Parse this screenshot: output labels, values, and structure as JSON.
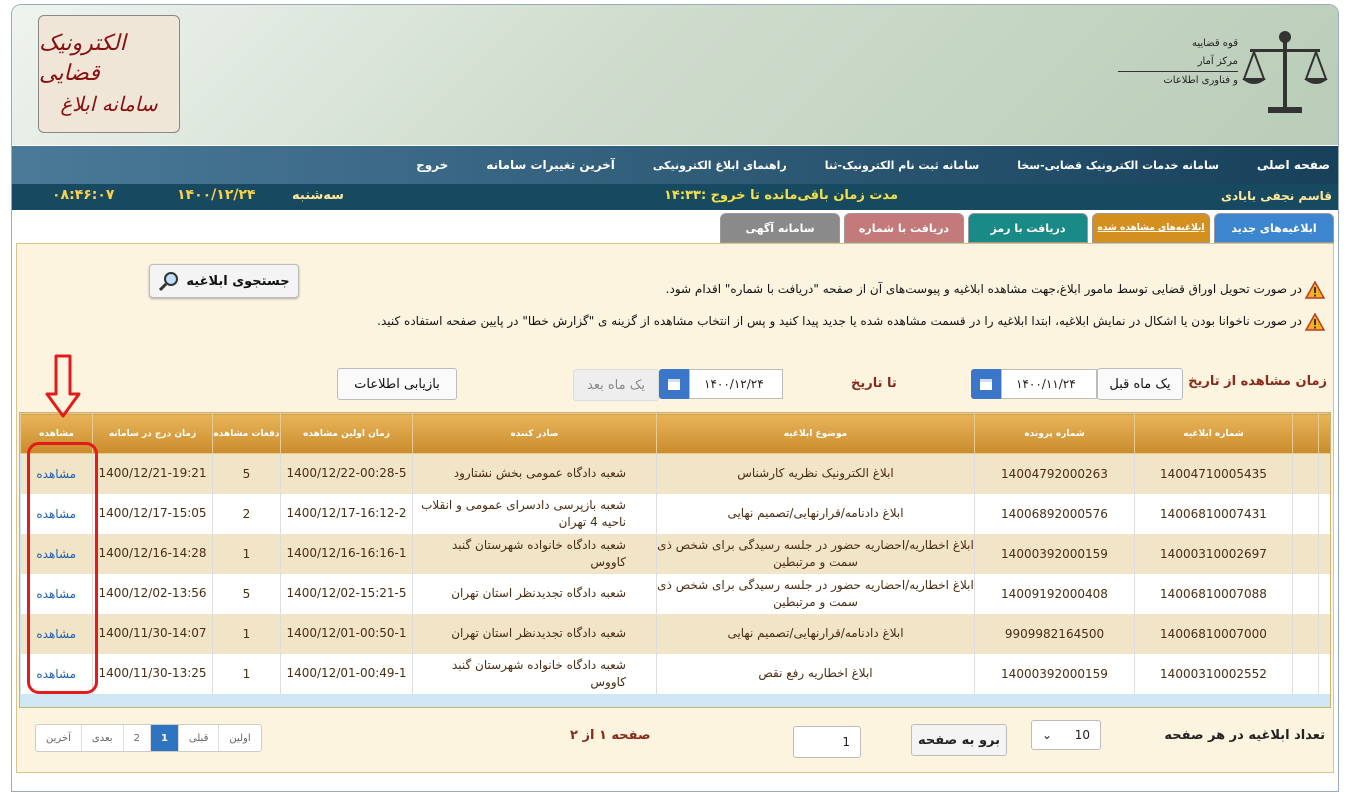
{
  "header": {
    "logo_left_line1": "الکترونیک قضایی",
    "logo_left_line2": "سامانه ابلاغ",
    "org_line1": "قوه قضاییه",
    "org_line2": "مرکز آمار",
    "org_line3": "و فناوری اطلاعات"
  },
  "nav": [
    "صفحه اصلی",
    "سامانه خدمات الکترونیک قضایی-سخا",
    "سامانه ثبت نام الکترونیک-ثنا",
    "راهنمای ابلاغ الکترونیکی",
    "آخرین تغییرات سامانه",
    "خروج"
  ],
  "status": {
    "user": "قاسم نجفی بابادی",
    "timer": "مدت زمان باقی‌مانده تا خروج :۱۴:۳۳",
    "day": "سه‌شنبه",
    "date": "۱۴۰۰/۱۲/۲۴",
    "clock": "۰۸:۴۶:۰۷"
  },
  "tabs": [
    {
      "label": "ابلاغیه‌های جدید",
      "color": "#3b86cf"
    },
    {
      "label": "ابلاغیه‌های مشاهده شده",
      "color": "#d4901e"
    },
    {
      "label": "دریافت با رمز",
      "color": "#1a8a86"
    },
    {
      "label": "دریافت با شماره",
      "color": "#c47a7a"
    },
    {
      "label": "سامانه آگهی",
      "color": "#8a8a8a"
    }
  ],
  "search_button": "جستجوی ابلاغیه",
  "notice1": "در صورت تحویل اوراق قضایی توسط مامور ابلاغ،جهت مشاهده ابلاغیه و پیوست‌های آن از صفحه \"دریافت با شماره\" اقدام شود.",
  "notice2": "در صورت ناخوانا بودن یا اشکال در نمایش ابلاغیه، ابتدا ابلاغیه را در قسمت مشاهده شده یا جدید پیدا کنید و پس از انتخاب مشاهده از گزینه ی \"گزارش خطا\" در پایین صفحه استفاده کنید.",
  "filters": {
    "from_label": "زمان مشاهده از تاریخ",
    "month_before_btn": "یک ماه قبل",
    "from_date": "۱۴۰۰/۱۱/۲۴",
    "to_label": "تا تاریخ",
    "to_date": "۱۴۰۰/۱۲/۲۴",
    "month_after_btn": "یک ماه بعد",
    "refresh_btn": "بازیابی اطلاعات"
  },
  "table": {
    "headers": [
      "شماره ابلاغیه",
      "شماره پرونده",
      "موضوع ابلاغیه",
      "صادر کننده",
      "زمان اولین مشاهده",
      "دفعات مشاهده",
      "زمان درج در سامانه",
      "مشاهده"
    ],
    "rows": [
      {
        "num": "14004710005435",
        "case": "14004792000263",
        "subject": "ابلاغ الکترونیک نظریه کارشناس",
        "issuer": "شعبه دادگاه عمومی بخش نشتارود",
        "first_view": "1400/12/22-00:28-5",
        "count": "5",
        "inserted": "1400/12/21-19:21",
        "view": "مشاهده"
      },
      {
        "num": "14006810007431",
        "case": "14006892000576",
        "subject": "ابلاغ دادنامه/قرارنهایی/تصمیم نهایی",
        "issuer": "شعبه بازپرسی دادسرای عمومی و انقلاب ناحیه 4 تهران",
        "first_view": "1400/12/17-16:12-2",
        "count": "2",
        "inserted": "1400/12/17-15:05",
        "view": "مشاهده"
      },
      {
        "num": "14000310002697",
        "case": "14000392000159",
        "subject": "ابلاغ اخطاریه/احضاریه حضور در جلسه رسیدگی برای شخص ذی سمت و مرتبطین",
        "issuer": "شعبه دادگاه خانواده شهرستان گنبد کاووس",
        "first_view": "1400/12/16-16:16-1",
        "count": "1",
        "inserted": "1400/12/16-14:28",
        "view": "مشاهده"
      },
      {
        "num": "14006810007088",
        "case": "14009192000408",
        "subject": "ابلاغ اخطاریه/احضاریه حضور در جلسه رسیدگی برای شخص ذی سمت و مرتبطین",
        "issuer": "شعبه دادگاه تجدیدنظر استان تهران",
        "first_view": "1400/12/02-15:21-5",
        "count": "5",
        "inserted": "1400/12/02-13:56",
        "view": "مشاهده"
      },
      {
        "num": "14006810007000",
        "case": "9909982164500",
        "subject": "ابلاغ دادنامه/قرارنهایی/تصمیم نهایی",
        "issuer": "شعبه دادگاه تجدیدنظر استان تهران",
        "first_view": "1400/12/01-00:50-1",
        "count": "1",
        "inserted": "1400/11/30-14:07",
        "view": "مشاهده"
      },
      {
        "num": "14000310002552",
        "case": "14000392000159",
        "subject": "ابلاغ اخطاریه رفع نقص",
        "issuer": "شعبه دادگاه خانواده شهرستان گنبد کاووس",
        "first_view": "1400/12/01-00:49-1",
        "count": "1",
        "inserted": "1400/11/30-13:25",
        "view": "مشاهده"
      }
    ]
  },
  "pager": {
    "items": [
      "آخرین",
      "بعدی",
      "2",
      "1",
      "قبلی",
      "اولین"
    ],
    "page_info": "صفحه ۱ از ۲",
    "page_input": "1",
    "go_btn": "برو به صفحه",
    "per_page_value": "10",
    "per_page_label": "تعداد ابلاغیه در هر صفحه"
  }
}
